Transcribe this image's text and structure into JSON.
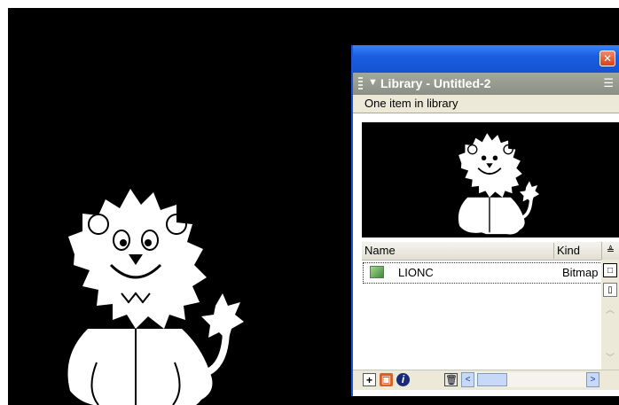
{
  "panel": {
    "close_glyph": "✕",
    "header_title": "Library - Untitled-2",
    "collapse_glyph": "▼",
    "options_glyph": "☰",
    "item_count": "One item in library"
  },
  "columns": {
    "name": "Name",
    "kind": "Kind",
    "sort_glyph": "≜"
  },
  "items": [
    {
      "name": "LIONC",
      "kind": "Bitmap",
      "icon": "bitmap-icon"
    }
  ],
  "side_buttons": [
    "□",
    "▯",
    "︿",
    "﹀"
  ],
  "bottom_icons": [
    "new-symbol-icon",
    "new-folder-icon",
    "properties-icon",
    "delete-icon"
  ],
  "bottom_glyphs": {
    "new_symbol": "+",
    "new_folder": "▣",
    "properties": "i",
    "trash": "🗑",
    "scroll_left": "<",
    "scroll_right": ">"
  },
  "colors": {
    "titlebar": "#1a5ee0",
    "stage": "#000000",
    "header": "#9a9e92"
  }
}
